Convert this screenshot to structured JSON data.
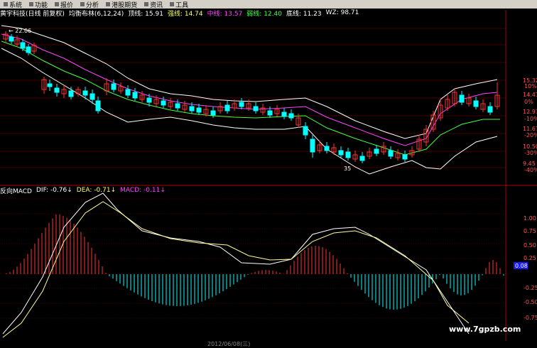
{
  "menu": [
    {
      "label": "系统",
      "icon": "system-icon"
    },
    {
      "label": "功能",
      "icon": "function-icon"
    },
    {
      "label": "报价",
      "icon": "quote-icon"
    },
    {
      "label": "分析",
      "icon": "analysis-icon"
    },
    {
      "label": "港股期货",
      "icon": "futures-icon"
    },
    {
      "label": "资讯",
      "icon": "news-icon"
    },
    {
      "label": "工具",
      "icon": "tools-icon"
    }
  ],
  "main_header": {
    "stock": "黄宇科技(日线 前复权)",
    "indicator": "均衡布林(6,12,24)",
    "top": {
      "label": "顶线: ",
      "value": "15.91",
      "color": "#ffffff"
    },
    "upper": {
      "label": "强线: ",
      "value": "14.74",
      "color": "#ffff66"
    },
    "mid": {
      "label": "中线: ",
      "value": "13.57",
      "color": "#ff44ff"
    },
    "weak": {
      "label": "弱线: ",
      "value": "12.40",
      "color": "#44ff44"
    },
    "bottom": {
      "label": "底线: ",
      "value": "11.23",
      "color": "#ffffff"
    },
    "wz": {
      "label": "WZ: ",
      "value": "98.71",
      "color": "#ffffff"
    }
  },
  "sub_header": {
    "name": "反向MACD",
    "dif": {
      "label": "DIF: ",
      "value": "-0.76",
      "color": "#ffffff"
    },
    "dea": {
      "label": "DEA: ",
      "value": "-0.71",
      "color": "#ffff66"
    },
    "macd": {
      "label": "MACD: ",
      "value": "-0.11",
      "color": "#ff44ff"
    }
  },
  "price_axis": [
    "15.32",
    "14.41",
    "12.97",
    "11.67",
    "10.50",
    "9.45"
  ],
  "pct_axis": [
    "10%",
    "0%",
    "-10%",
    "-20%",
    "-30%",
    "-40%"
  ],
  "macd_axis": [
    "1.00",
    "0.75",
    "0.50",
    "0.25",
    "0.08",
    "-0.25",
    "-0.50",
    "-0.75"
  ],
  "macd_highlight": "0.08",
  "annotations": {
    "high": "22.06",
    "low": "35"
  },
  "bottom_date": "2012/06/08(三)",
  "watermark": "www.7gpzb.com",
  "colors": {
    "up": "#ff3333",
    "down": "#00ffff",
    "grid": "#880000"
  }
}
